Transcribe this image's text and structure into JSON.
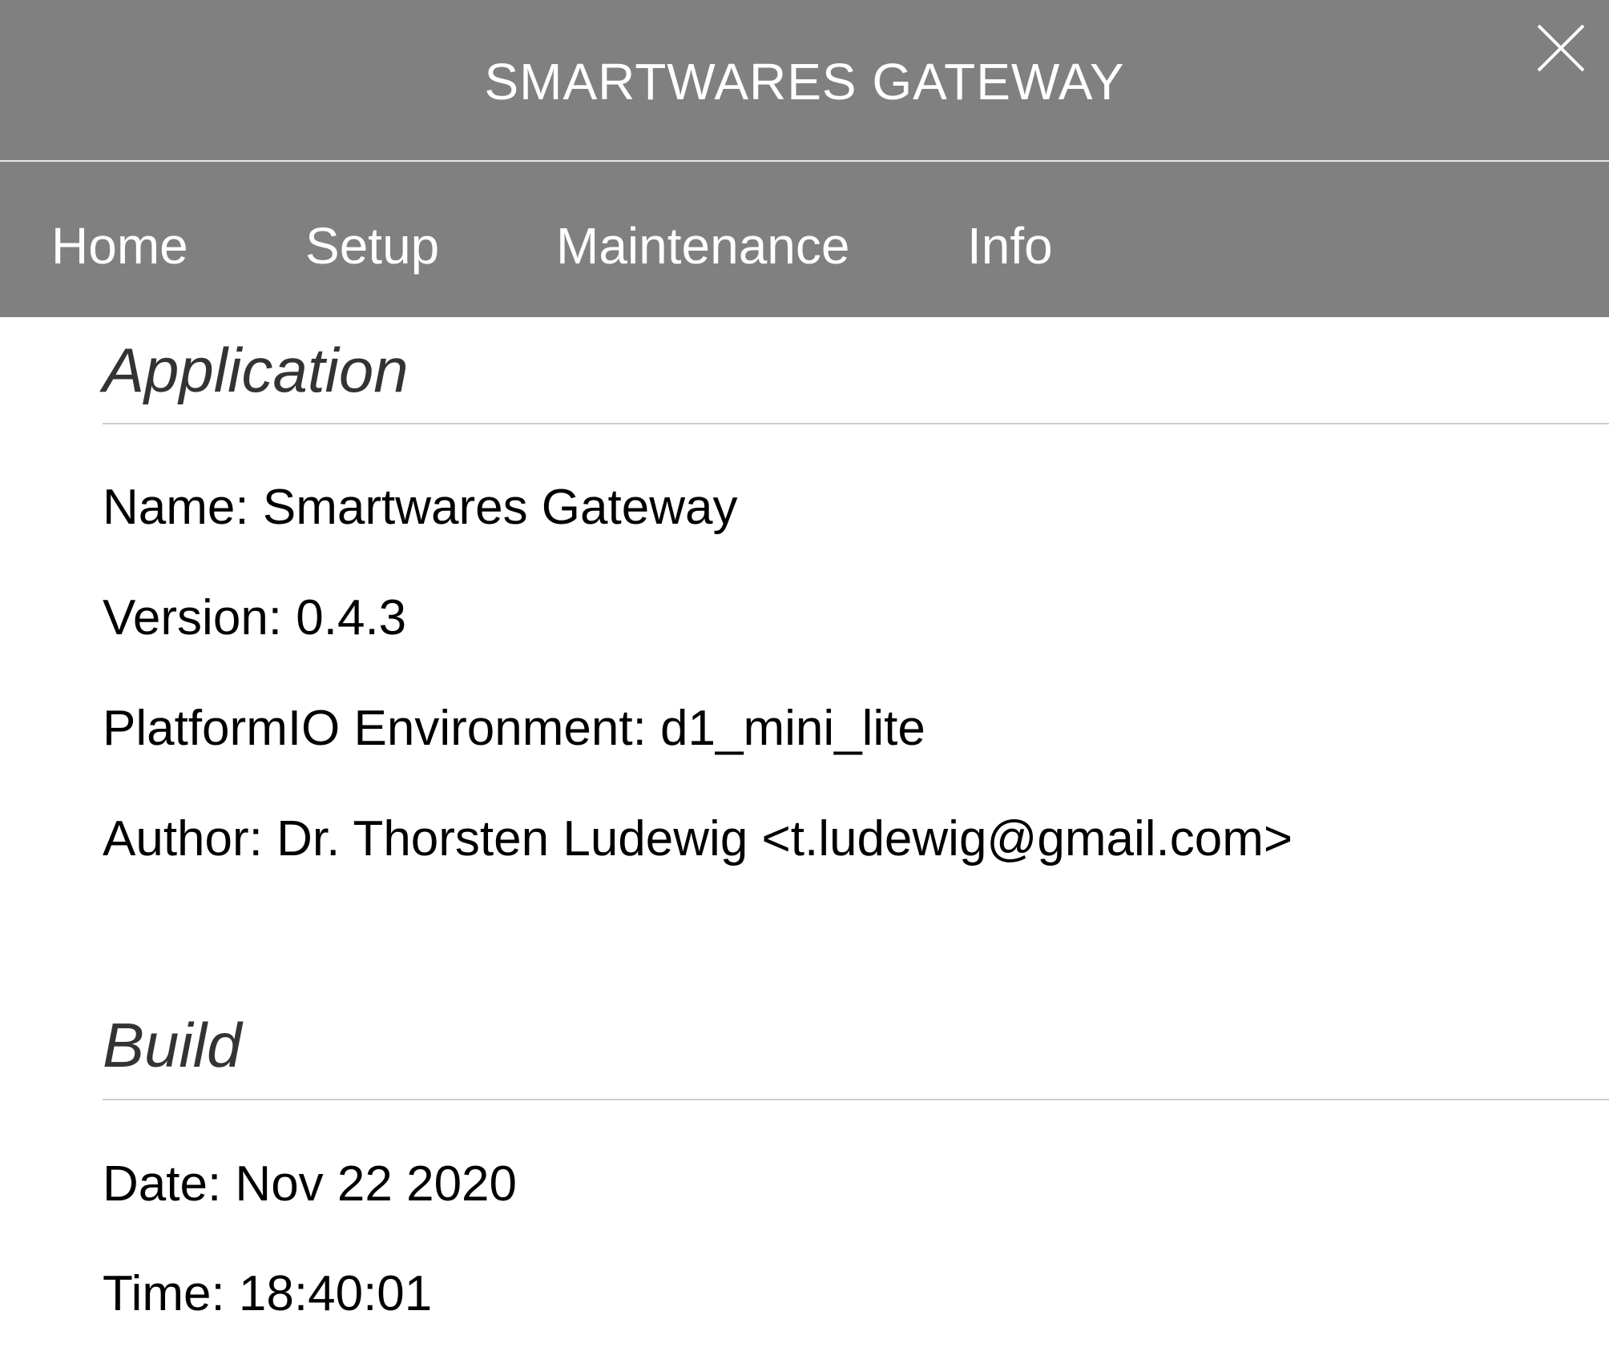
{
  "header": {
    "title": "SMARTWARES GATEWAY",
    "close_icon": "close-icon"
  },
  "nav": {
    "items": [
      {
        "label": "Home"
      },
      {
        "label": "Setup"
      },
      {
        "label": "Maintenance"
      },
      {
        "label": "Info"
      }
    ]
  },
  "sections": {
    "application": {
      "heading": "Application",
      "lines": [
        "Name: Smartwares Gateway",
        "Version: 0.4.3",
        "PlatformIO Environment: d1_mini_lite",
        "Author: Dr. Thorsten Ludewig <t.ludewig@gmail.com>"
      ]
    },
    "build": {
      "heading": "Build",
      "lines": [
        "Date: Nov 22 2020",
        "Time: 18:40:01"
      ]
    }
  },
  "colors": {
    "header_bg": "#808080",
    "header_text": "#ffffff",
    "heading_text": "#333333",
    "body_text": "#000000"
  }
}
